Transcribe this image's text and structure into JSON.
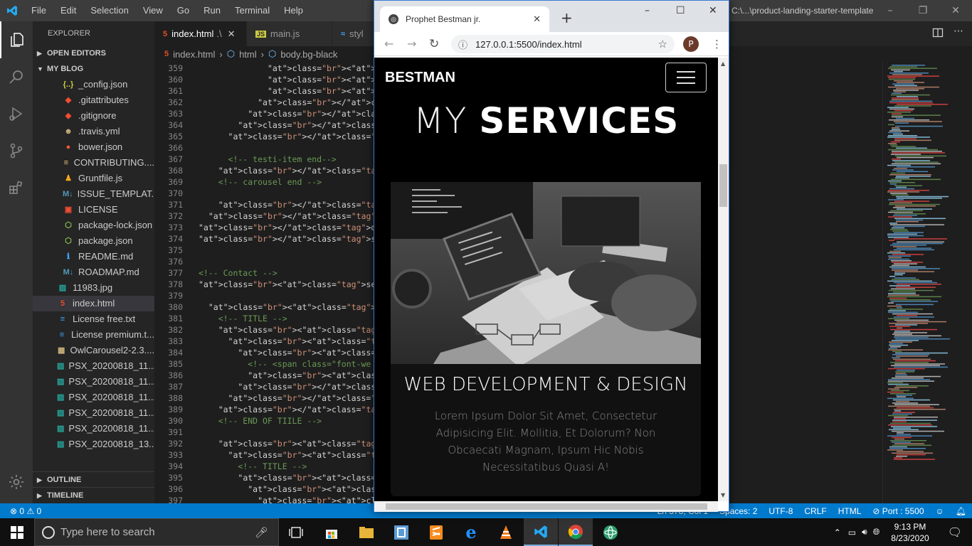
{
  "titlebar": {
    "menu": [
      "File",
      "Edit",
      "Selection",
      "View",
      "Go",
      "Run",
      "Terminal",
      "Help"
    ],
    "path_text": "C:\\...\\product-landing-starter-template"
  },
  "explorer": {
    "title": "EXPLORER",
    "open_editors": "OPEN EDITORS",
    "folder": "MY BLOG",
    "files": [
      {
        "name": "_config.json",
        "icon": "{..}",
        "color": "#cbcb41"
      },
      {
        "name": ".gitattributes",
        "icon": "◆",
        "color": "#f14e32"
      },
      {
        "name": ".gitignore",
        "icon": "◆",
        "color": "#f14e32"
      },
      {
        "name": ".travis.yml",
        "icon": "☻",
        "color": "#cbb27c"
      },
      {
        "name": "bower.json",
        "icon": "●",
        "color": "#ef5734"
      },
      {
        "name": "CONTRIBUTING....",
        "icon": "≡",
        "color": "#e5c07b"
      },
      {
        "name": "Gruntfile.js",
        "icon": "♟",
        "color": "#fba919"
      },
      {
        "name": "ISSUE_TEMPLAT...",
        "icon": "M↓",
        "color": "#519aba"
      },
      {
        "name": "LICENSE",
        "icon": "▣",
        "color": "#f14e32"
      },
      {
        "name": "package-lock.json",
        "icon": "⬡",
        "color": "#8bc34a"
      },
      {
        "name": "package.json",
        "icon": "⬡",
        "color": "#8bc34a"
      },
      {
        "name": "README.md",
        "icon": "ℹ",
        "color": "#42a5f5"
      },
      {
        "name": "ROADMAP.md",
        "icon": "M↓",
        "color": "#519aba"
      }
    ],
    "root_files": [
      {
        "name": "11983.jpg",
        "icon": "▨",
        "color": "#26a69a"
      },
      {
        "name": "index.html",
        "icon": "5",
        "color": "#e44d26",
        "selected": true
      },
      {
        "name": "License free.txt",
        "icon": "≡",
        "color": "#42a5f5"
      },
      {
        "name": "License premium.t...",
        "icon": "≡",
        "color": "#42a5f5"
      },
      {
        "name": "OwlCarousel2-2.3....",
        "icon": "▦",
        "color": "#cbb27c"
      },
      {
        "name": "PSX_20200818_11...",
        "icon": "▨",
        "color": "#26a69a"
      },
      {
        "name": "PSX_20200818_11...",
        "icon": "▨",
        "color": "#26a69a"
      },
      {
        "name": "PSX_20200818_11...",
        "icon": "▨",
        "color": "#26a69a"
      },
      {
        "name": "PSX_20200818_11...",
        "icon": "▨",
        "color": "#26a69a"
      },
      {
        "name": "PSX_20200818_11...",
        "icon": "▨",
        "color": "#26a69a"
      },
      {
        "name": "PSX_20200818_13...",
        "icon": "▨",
        "color": "#26a69a"
      }
    ],
    "outline": "OUTLINE",
    "timeline": "TIMELINE"
  },
  "tabs": [
    {
      "label": "index.html",
      "suffix": ".\\",
      "icon": "5",
      "color": "#e44d26",
      "active": true
    },
    {
      "label": "main.js",
      "icon": "JS",
      "color": "#cbcb41"
    },
    {
      "label": "styl",
      "icon": "≋",
      "color": "#42a5f5"
    }
  ],
  "breadcrumb": [
    "index.html",
    "html",
    "body.bg-black"
  ],
  "code": {
    "numbers": [
      "359",
      "360",
      "361",
      "362",
      "363",
      "364",
      "365",
      "366",
      "367",
      "368",
      "369",
      "370",
      "371",
      "372",
      "373",
      "374",
      "375",
      "376",
      "377",
      "378",
      "379",
      "380",
      "381",
      "382",
      "383",
      "384",
      "385",
      "386",
      "387",
      "388",
      "389",
      "390",
      "391",
      "392",
      "393",
      "394",
      "395",
      "396",
      "397"
    ],
    "lines": [
      "              <i class=\"fas fa-st",
      "              <i class=\"fas fa-st",
      "              <i class=\"fas fa-st",
      "            </div>",
      "          </div>",
      "        </div>",
      "      </div>",
      "",
      "      <!-- testi-item end-->",
      "    </div>",
      "    <!-- carousel end -->",
      "",
      "    </div>",
      "  </div>",
      "</div>",
      "</section>",
      "",
      "",
      "<!-- Contact -->",
      "<section id=\"contact\" class=\"py-3 m",
      "",
      "  <div class=\"container\">",
      "    <!-- TITLE -->",
      "    <div class=\"row\">",
      "      <div class=\"col py-3\">",
      "        <h1 class=\"display-4 text-c",
      "          <!-- <span class=\"font-we",
      "          <span class=\"text-light f",
      "        </h1>",
      "      </div>",
      "    </div>",
      "    <!-- END OF TIILE -->",
      "",
      "    <div class=\"row\">",
      "      <div class=\"col-lg-7\">",
      "        <!-- TITLE -->",
      "        <div class=\"row\">",
      "          <div class=\"col pt-5\">",
      "            <p class=\"text-center l"
    ]
  },
  "status": {
    "errors": "⊗ 0 ⚠ 0",
    "right": [
      "Ln 378, Col 1",
      "Spaces: 2",
      "UTF-8",
      "CRLF",
      "HTML",
      "⊘ Port : 5500"
    ]
  },
  "taskbar": {
    "search_placeholder": "Type here to search",
    "time": "9:13 PM",
    "date": "8/23/2020"
  },
  "browser": {
    "tab_title": "Prophet Bestman jr.",
    "url": "127.0.0.1:5500/index.html",
    "avatar_letter": "P",
    "page": {
      "brand": "BESTMAN",
      "heading_light": "MY",
      "heading_bold": "SERVICES",
      "card_title": "WEB DEVELOPMENT & DESIGN",
      "card_text": "Lorem Ipsum Dolor Sit Amet, Consectetur Adipisicing Elit. Mollitia, Et Dolorum? Non Obcaecati Magnam, Ipsum Hic Nobis Necessitatibus Quasi A!"
    }
  }
}
